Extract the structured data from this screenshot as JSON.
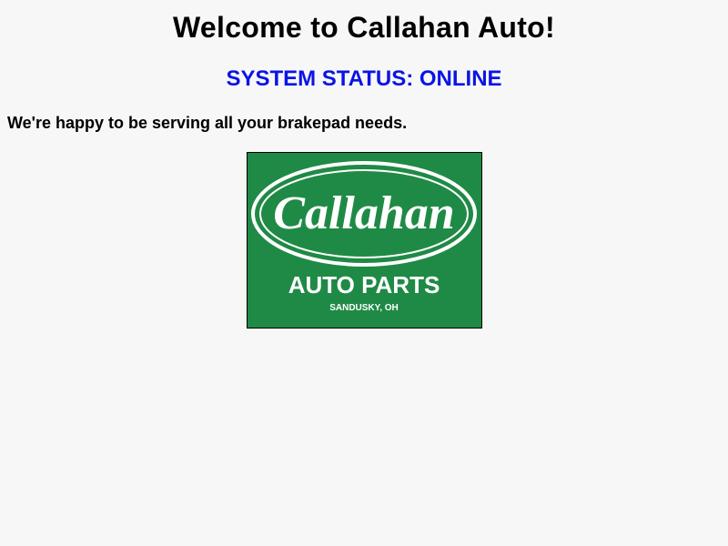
{
  "page": {
    "title": "Welcome to Callahan Auto!",
    "status_text": "SYSTEM STATUS: ONLINE",
    "tagline": "We're happy to be serving all your brakepad needs."
  },
  "logo": {
    "brand": "Callahan",
    "line2": "AUTO PARTS",
    "location": "SANDUSKY, OH"
  },
  "colors": {
    "background": "#f7f7f7",
    "status": "#0a14e6",
    "logo_green": "#1f8a45",
    "logo_ink": "#ffffff"
  }
}
